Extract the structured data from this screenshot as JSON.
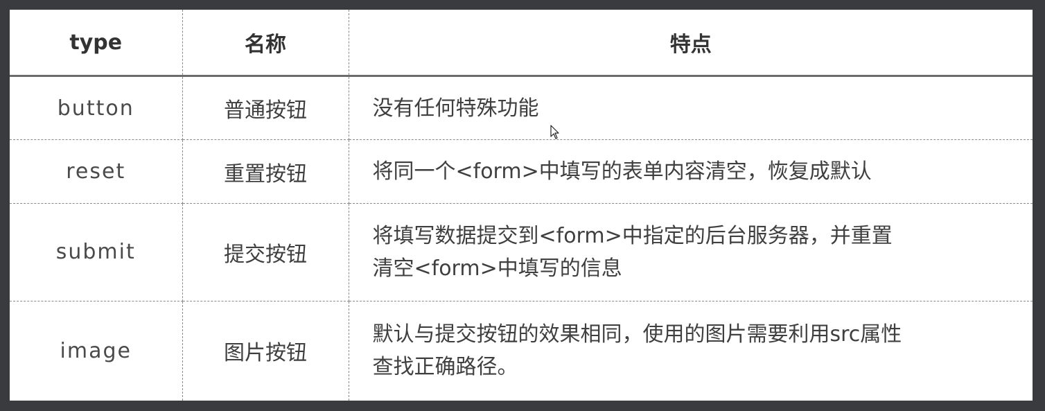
{
  "table": {
    "headers": {
      "type": "type",
      "name": "名称",
      "feature": "特点"
    },
    "rows": [
      {
        "type": "button",
        "name": "普通按钮",
        "feature_lines": [
          "没有任何特殊功能"
        ]
      },
      {
        "type": "reset",
        "name": "重置按钮",
        "feature_lines": [
          "将同一个<form>中填写的表单内容清空，恢复成默认"
        ]
      },
      {
        "type": "submit",
        "name": "提交按钮",
        "feature_lines": [
          "将填写数据提交到<form>中指定的后台服务器，并重置",
          "清空<form>中填写的信息"
        ]
      },
      {
        "type": "image",
        "name": "图片按钮",
        "feature_lines": [
          "默认与提交按钮的效果相同，使用的图片需要利用src属性",
          "查找正确路径。"
        ]
      }
    ]
  },
  "cursor_icon": "mouse-pointer-icon"
}
